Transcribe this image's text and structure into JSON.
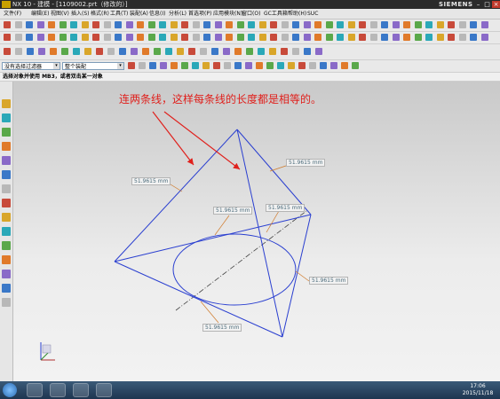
{
  "window": {
    "title": "NX 10 - 建模 - [1109002.prt（修改的）]",
    "brand": "SIEMENS",
    "controls": [
      "–",
      "□",
      "×"
    ]
  },
  "menu": [
    "文件(F)",
    "编辑(E)",
    "视图(V)",
    "插入(S)",
    "格式(R)",
    "工具(T)",
    "装配(A)",
    "信息(I)",
    "分析(L)",
    "首选项(P)",
    "应用模块(N)",
    "窗口(O)",
    "GC工具箱",
    "帮助(H)",
    "SUC"
  ],
  "selection": {
    "filter": "没有选择过滤器",
    "scope": "整个装配"
  },
  "cue_line": "选择对象并使用 MB3，或者双击某一对象",
  "annotation": "连两条线，这样每条线的长度都是相等的。",
  "dimensions": [
    "51.9615 mm",
    "51.9615 mm",
    "51.9615 mm",
    "51.9615 mm",
    "51.9615 mm",
    "51.9615 mm"
  ],
  "taskbar": {
    "time": "17:06",
    "date": "2015/11/18"
  },
  "colors": {
    "sketch_line": "#2a3fd0",
    "annotation_text": "#e0201c",
    "annotation_arrow": "#e0201c",
    "dimension_leader": "#d07a2a"
  }
}
